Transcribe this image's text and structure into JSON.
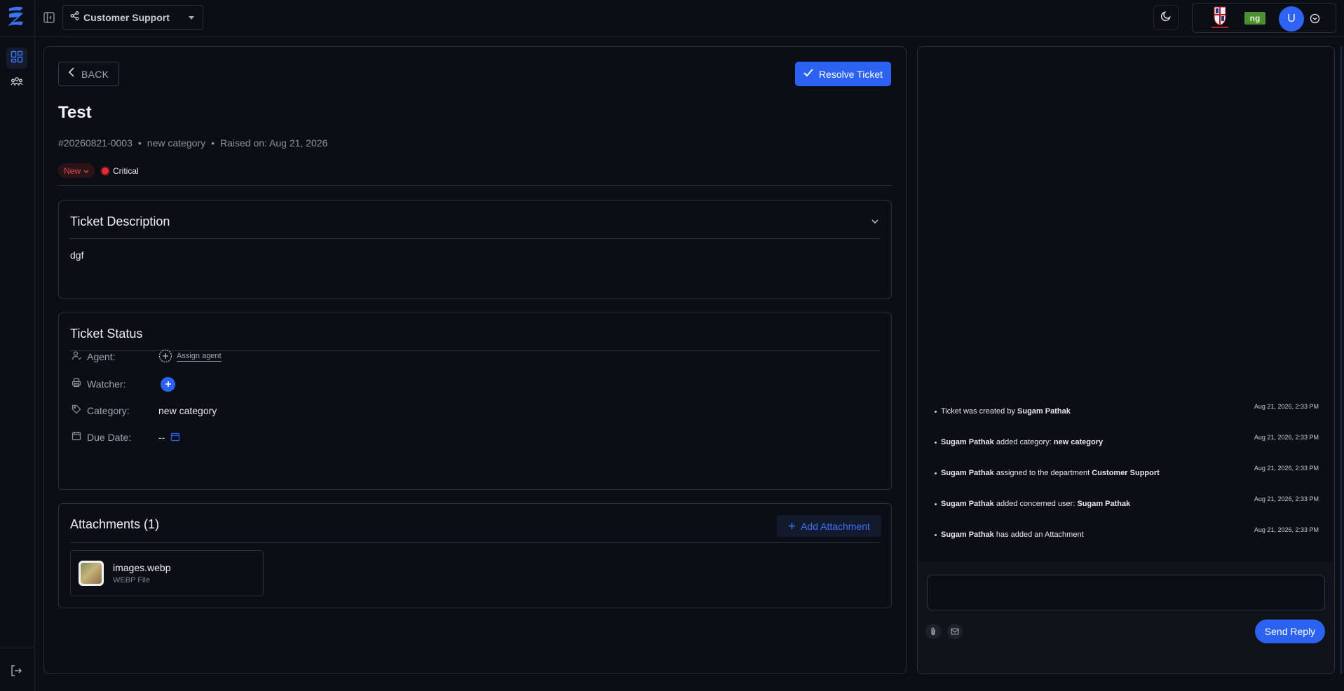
{
  "header": {
    "department": "Customer Support",
    "user_initial": "U",
    "org_badge": "ng"
  },
  "ticket": {
    "back_label": "BACK",
    "resolve_label": "Resolve Ticket",
    "title": "Test",
    "number": "#20260821-0003",
    "category": "new category",
    "raised_on": "Raised on: Aug 21, 2026",
    "status": "New",
    "priority": "Critical",
    "priority_color": "#e52b35"
  },
  "description": {
    "heading": "Ticket Description",
    "body": "dgf"
  },
  "status_card": {
    "heading": "Ticket Status",
    "agent_label": "Agent:",
    "assign_label": "Assign agent",
    "watcher_label": "Watcher:",
    "category_label": "Category:",
    "category_value": "new category",
    "due_label": "Due Date:",
    "due_value": "--"
  },
  "attachments": {
    "heading": "Attachments (1)",
    "add_label": "Add Attachment",
    "files": [
      {
        "name": "images.webp",
        "type": "WEBP File"
      }
    ]
  },
  "activity": [
    {
      "actor": "",
      "pre": "Ticket was created by ",
      "bold": "Sugam Pathak",
      "post": "",
      "time": "Aug 21, 2026, 2:33 PM"
    },
    {
      "actor": "Sugam Pathak",
      "pre": " added category: ",
      "bold": "new category",
      "post": "",
      "time": "Aug 21, 2026, 2:33 PM"
    },
    {
      "actor": "Sugam Pathak",
      "pre": " assigned to the department ",
      "bold": "Customer Support",
      "post": "",
      "time": "Aug 21, 2026, 2:33 PM"
    },
    {
      "actor": "Sugam Pathak",
      "pre": " added concerned user: ",
      "bold": "Sugam Pathak",
      "post": "",
      "time": "Aug 21, 2026, 2:33 PM"
    },
    {
      "actor": "Sugam Pathak",
      "pre": " has added an Attachment",
      "bold": "",
      "post": "",
      "time": "Aug 21, 2026, 2:33 PM"
    }
  ],
  "composer": {
    "send_label": "Send Reply"
  },
  "colors": {
    "accent": "#2b62f2",
    "background": "#0b0e15",
    "status_new": "#e24a56"
  }
}
